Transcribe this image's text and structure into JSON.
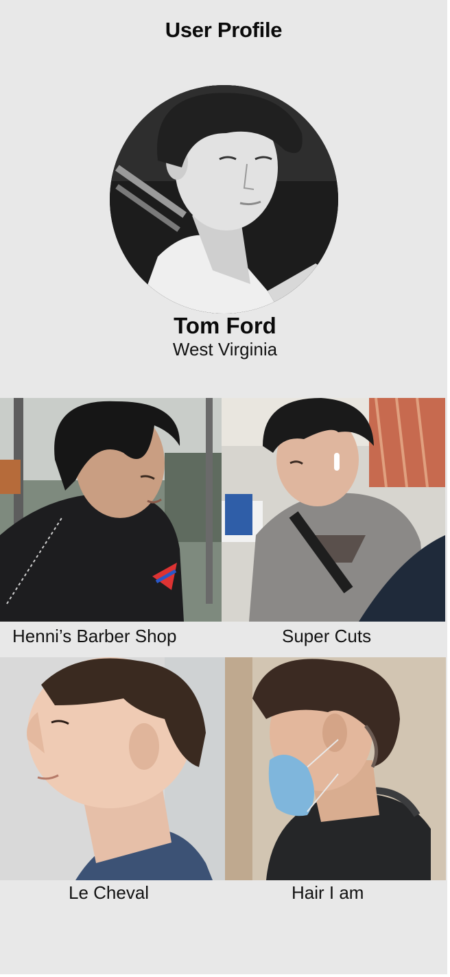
{
  "header": {
    "title": "User Profile"
  },
  "profile": {
    "name": "Tom Ford",
    "location": "West Virginia",
    "avatar_icon": "portrait-photo"
  },
  "shops": [
    {
      "name": "Henni’s Barber Shop"
    },
    {
      "name": "Super Cuts"
    },
    {
      "name": "Le Cheval"
    },
    {
      "name": "Hair I am"
    }
  ],
  "colors": {
    "background": "#e8e8e8",
    "text": "#0a0a0a"
  }
}
